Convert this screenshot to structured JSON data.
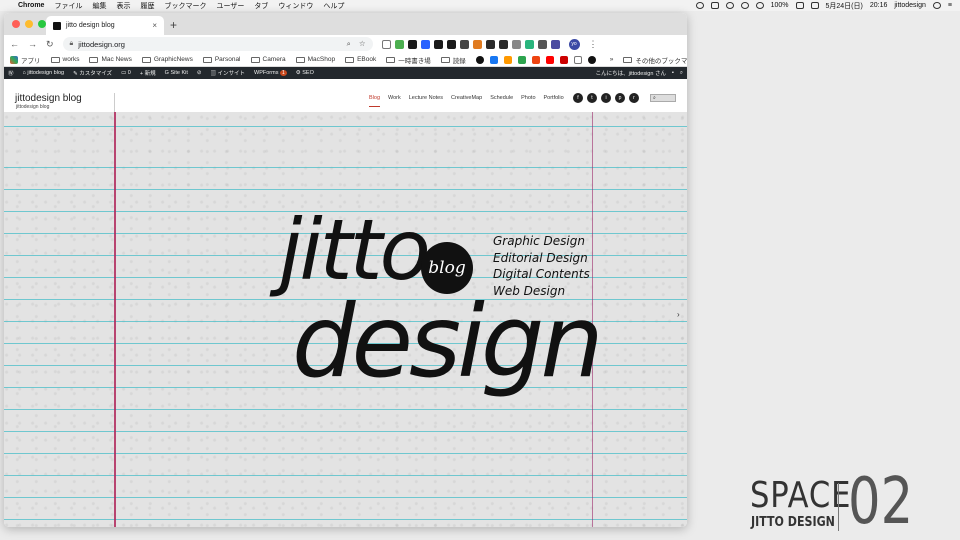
{
  "menubar": {
    "apple": "",
    "app": "Chrome",
    "items": [
      "ファイル",
      "編集",
      "表示",
      "履歴",
      "ブックマーク",
      "ユーザー",
      "タブ",
      "ウィンドウ",
      "ヘルプ"
    ],
    "battery": "100%",
    "date": "5月24日(日)",
    "time": "20:16",
    "user": "jittodesign"
  },
  "browser": {
    "tab_title": "jitto design blog",
    "tab_close": "×",
    "new_tab": "+",
    "url": "jittodesign.org",
    "avatar": "yo",
    "more": "⋮"
  },
  "bookmarks": {
    "apps": "アプリ",
    "items": [
      "works",
      "Mac News",
      "GraphicNews",
      "Parsonal",
      "Camera",
      "MacShop",
      "EBook",
      "一時書き場",
      "読録"
    ],
    "more": "»",
    "other": "その他のブックマーク"
  },
  "wpbar": {
    "site": "jittodesign blog",
    "customize": "カスタマイズ",
    "comments": "0",
    "new": "新規",
    "sitekit": "Site Kit",
    "insights": "インサイト",
    "wpforms": "WPForms",
    "wpforms_badge": "1",
    "seo": "SEO",
    "greeting": "こんにちは、jittodesign さん"
  },
  "site": {
    "title": "jittodesign blog",
    "tagline": "jittodesign blog",
    "nav": [
      "Blog",
      "Work",
      "Lecture Notes",
      "CreativeMap",
      "Schedule",
      "Photo",
      "Portfolio"
    ],
    "social": [
      "f",
      "t",
      "i",
      "p",
      "r"
    ],
    "search_icon": "search-icon"
  },
  "hero": {
    "logo_line1": "jitto",
    "logo_line2": "design",
    "badge": "blog",
    "services": [
      "Graphic Design",
      "Editorial Design",
      "Digital Contents",
      "Web Design"
    ]
  },
  "watermark": {
    "word": "SPACE",
    "number": "02",
    "sub": "JITTO DESIGN"
  },
  "colors": {
    "rule_line": "#48bec8",
    "margin_line": "#b0285c",
    "nav_active": "#c0392b",
    "wp_bar": "#23282d"
  }
}
